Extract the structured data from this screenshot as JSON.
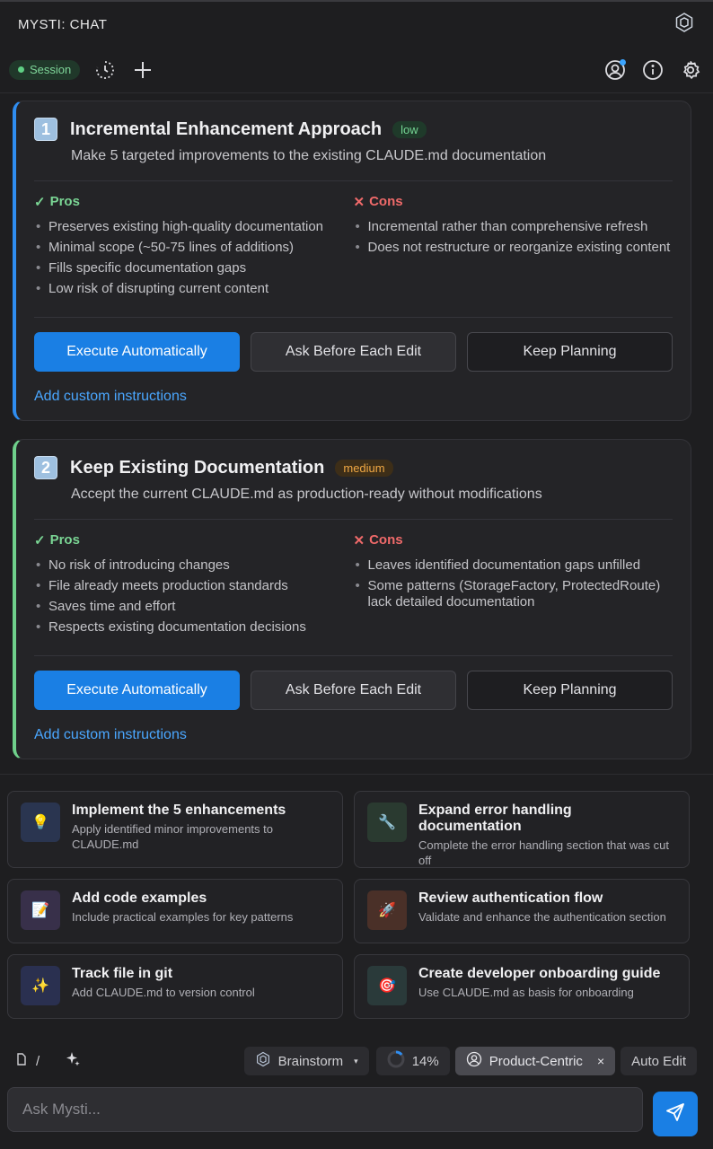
{
  "app": {
    "title": "MYSTI: CHAT"
  },
  "toolbar": {
    "session_label": "Session"
  },
  "options": [
    {
      "number": "1",
      "title": "Incremental Enhancement Approach",
      "badge": "low",
      "subtitle": "Make 5 targeted improvements to the existing CLAUDE.md documentation",
      "pros_label": "Pros",
      "cons_label": "Cons",
      "pros": [
        "Preserves existing high-quality documentation",
        "Minimal scope (~50-75 lines of additions)",
        "Fills specific documentation gaps",
        "Low risk of disrupting current content"
      ],
      "cons": [
        "Incremental rather than comprehensive refresh",
        "Does not restructure or reorganize existing content"
      ],
      "execute_label": "Execute Automatically",
      "ask_label": "Ask Before Each Edit",
      "keep_label": "Keep Planning",
      "custom_label": "Add custom instructions"
    },
    {
      "number": "2",
      "title": "Keep Existing Documentation",
      "badge": "medium",
      "subtitle": "Accept the current CLAUDE.md as production-ready without modifications",
      "pros_label": "Pros",
      "cons_label": "Cons",
      "pros": [
        "No risk of introducing changes",
        "File already meets production standards",
        "Saves time and effort",
        "Respects existing documentation decisions"
      ],
      "cons": [
        "Leaves identified documentation gaps unfilled",
        "Some patterns (StorageFactory, ProtectedRoute) lack detailed documentation"
      ],
      "execute_label": "Execute Automatically",
      "ask_label": "Ask Before Each Edit",
      "keep_label": "Keep Planning",
      "custom_label": "Add custom instructions"
    }
  ],
  "suggestions": [
    {
      "icon": "lightbulb-icon",
      "glyph": "💡",
      "bg": "#2a3550",
      "title": "Implement the 5 enhancements",
      "desc": "Apply identified minor improvements to CLAUDE.md"
    },
    {
      "icon": "wrench-icon",
      "glyph": "🔧",
      "bg": "#2a3a30",
      "title": "Expand error handling documentation",
      "desc": "Complete the error handling section that was cut off"
    },
    {
      "icon": "memo-icon",
      "glyph": "📝",
      "bg": "#38304a",
      "title": "Add code examples",
      "desc": "Include practical examples for key patterns"
    },
    {
      "icon": "rocket-icon",
      "glyph": "🚀",
      "bg": "#4a3028",
      "title": "Review authentication flow",
      "desc": "Validate and enhance the authentication section"
    },
    {
      "icon": "sparkles-icon",
      "glyph": "✨",
      "bg": "#2a3050",
      "title": "Track file in git",
      "desc": "Add CLAUDE.md to version control"
    },
    {
      "icon": "target-icon",
      "glyph": "🎯",
      "bg": "#2a3a3a",
      "title": "Create developer onboarding guide",
      "desc": "Use CLAUDE.md as basis for onboarding"
    }
  ],
  "bottom": {
    "slash": "/",
    "mode_label": "Brainstorm",
    "progress_label": "14%",
    "progress": 0.14,
    "persona_label": "Product-Centric",
    "persona_close": "×",
    "auto_edit_label": "Auto Edit"
  },
  "input": {
    "placeholder": "Ask Mysti..."
  },
  "colors": {
    "accent": "#1a7fe4",
    "pros": "#7ad594",
    "cons": "#f06a6a",
    "low": "#74d493",
    "medium": "#f0a844"
  }
}
